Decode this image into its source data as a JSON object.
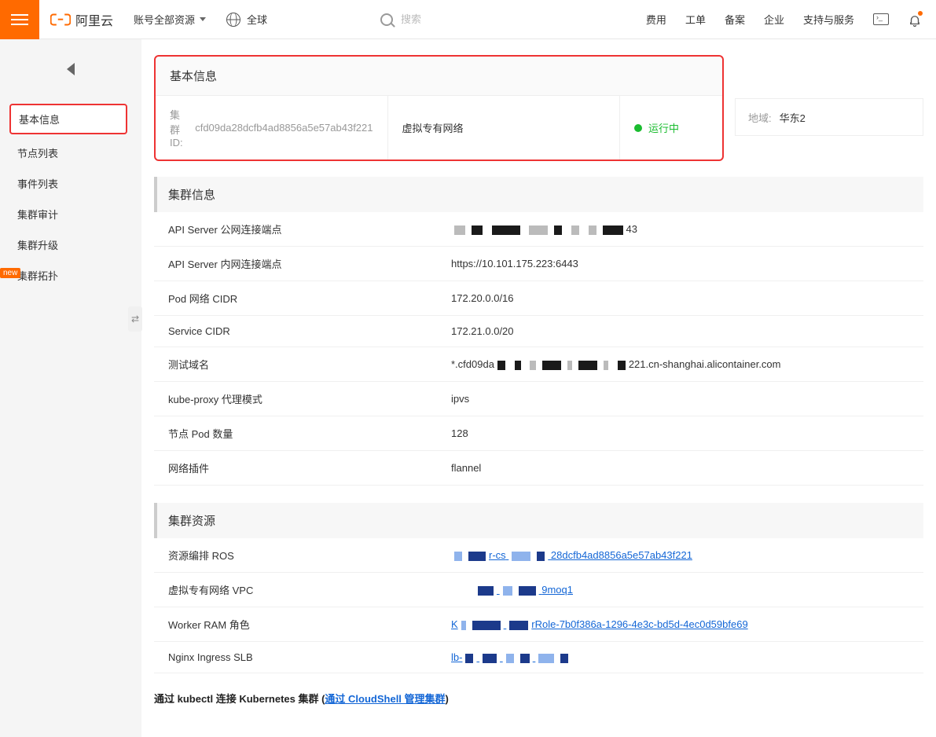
{
  "header": {
    "logo_text": "阿里云",
    "account_scope": "账号全部资源",
    "region": "全球",
    "search_placeholder": "搜索",
    "links": [
      "费用",
      "工单",
      "备案",
      "企业",
      "支持与服务"
    ]
  },
  "sidebar": {
    "items": [
      {
        "label": "基本信息",
        "active": true
      },
      {
        "label": "节点列表"
      },
      {
        "label": "事件列表"
      },
      {
        "label": "集群审计"
      },
      {
        "label": "集群升级"
      },
      {
        "label": "集群拓扑",
        "badge": "new"
      }
    ]
  },
  "basic_card": {
    "title": "基本信息",
    "cluster_id_label": "集群ID:",
    "cluster_id": "cfd09da28dcfb4ad8856a5e57ab43f221",
    "network_type": "虚拟专有网络",
    "status": "运行中"
  },
  "region_box": {
    "label": "地域:",
    "value": "华东2"
  },
  "cluster_info": {
    "title": "集群信息",
    "rows": [
      {
        "label": "API Server 公网连接端点",
        "value_suffix": "43",
        "redacted": true
      },
      {
        "label": "API Server 内网连接端点",
        "value": "https://10.101.175.223:6443"
      },
      {
        "label": "Pod 网络 CIDR",
        "value": "172.20.0.0/16"
      },
      {
        "label": "Service CIDR",
        "value": "172.21.0.0/20"
      },
      {
        "label": "测试域名",
        "value_prefix": "*.cfd09da",
        "value_suffix": "221.cn-shanghai.alicontainer.com",
        "redacted": true
      },
      {
        "label": "kube-proxy 代理模式",
        "value": "ipvs"
      },
      {
        "label": "节点 Pod 数量",
        "value": "128"
      },
      {
        "label": "网络插件",
        "value": "flannel"
      }
    ]
  },
  "cluster_resources": {
    "title": "集群资源",
    "rows": [
      {
        "label": "资源编排 ROS",
        "link_mid": "r-cs",
        "link_suffix": "28dcfb4ad8856a5e57ab43f221"
      },
      {
        "label": "虚拟专有网络 VPC",
        "link_suffix": "9moq1"
      },
      {
        "label": "Worker RAM 角色",
        "link_prefix": "K",
        "link_suffix": "rRole-7b0f386a-1296-4e3c-bd5d-4ec0d59bfe69"
      },
      {
        "label": "Nginx Ingress SLB",
        "link_prefix": "lb-"
      }
    ]
  },
  "footer": {
    "prefix": "通过 kubectl 连接 Kubernetes 集群 (",
    "link": "通过 CloudShell 管理集群",
    "suffix": ")"
  }
}
